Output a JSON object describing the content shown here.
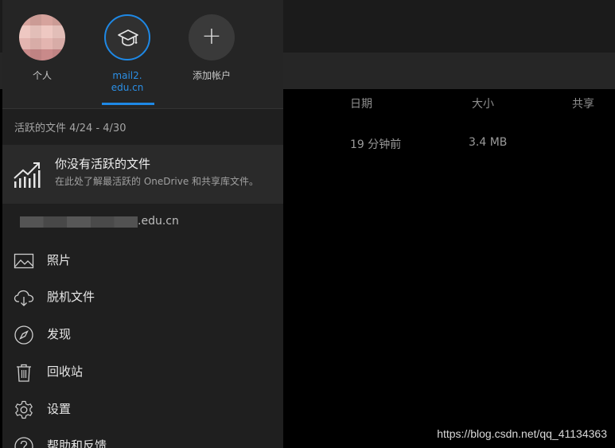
{
  "file_list": {
    "columns": [
      "日期",
      "大小",
      "共享"
    ],
    "rows": [
      {
        "date": "19 分钟前",
        "size": "3.4 MB"
      }
    ]
  },
  "drawer": {
    "accounts": [
      {
        "label": "个人",
        "icon": "avatar"
      },
      {
        "label_line1": "mail2.",
        "label_line2": "edu.cn",
        "icon": "graduation-cap-icon",
        "selected": true
      },
      {
        "label": "添加帐户",
        "icon": "plus-icon"
      }
    ],
    "active_files": {
      "header": "活跃的文件 4/24 - 4/30",
      "title": "你没有活跃的文件",
      "description": "在此处了解最活跃的 OneDrive 和共享库文件。"
    },
    "account_email_suffix": ".edu.cn",
    "nav": [
      {
        "label": "照片",
        "icon": "photo-icon"
      },
      {
        "label": "脱机文件",
        "icon": "cloud-download-icon"
      },
      {
        "label": "发现",
        "icon": "compass-icon"
      },
      {
        "label": "回收站",
        "icon": "trash-icon"
      },
      {
        "label": "设置",
        "icon": "gear-icon"
      },
      {
        "label": "帮助和反馈",
        "icon": "help-icon"
      }
    ]
  },
  "colors": {
    "accent": "#1e88e5",
    "drawer_bg": "#1f1f1f",
    "list_bg": "#000000"
  },
  "watermark": "https://blog.csdn.net/qq_41134363"
}
